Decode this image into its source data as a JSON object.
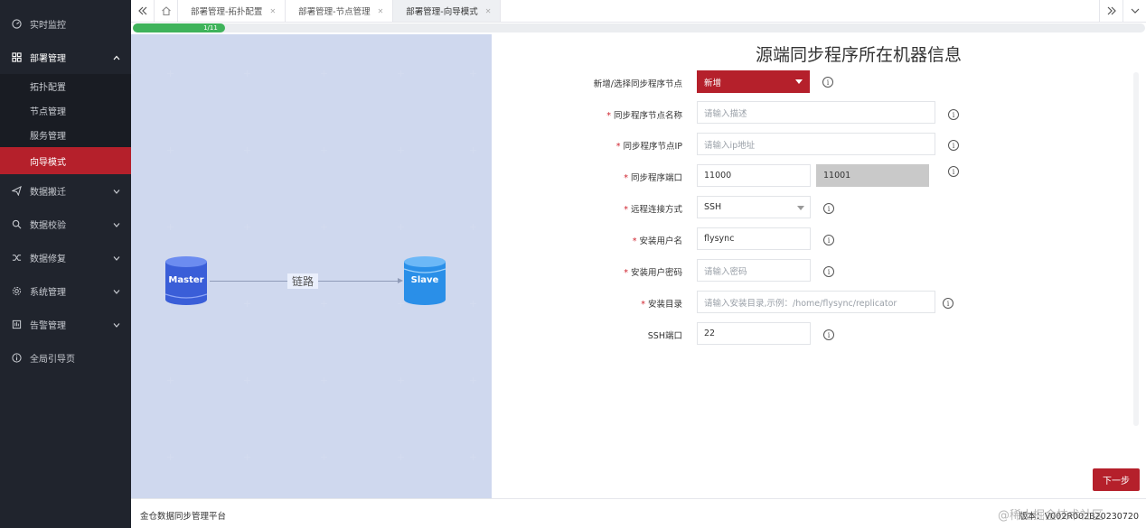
{
  "sidebar": {
    "items": [
      {
        "label": "实时监控",
        "icon": "dashboard-icon"
      },
      {
        "label": "部署管理",
        "icon": "deploy-icon",
        "expanded": true,
        "children": [
          {
            "label": "拓扑配置"
          },
          {
            "label": "节点管理"
          },
          {
            "label": "服务管理"
          },
          {
            "label": "向导模式",
            "active": true
          }
        ]
      },
      {
        "label": "数据搬迁",
        "icon": "send-icon"
      },
      {
        "label": "数据校验",
        "icon": "search-icon"
      },
      {
        "label": "数据修复",
        "icon": "shuffle-icon"
      },
      {
        "label": "系统管理",
        "icon": "gear-icon"
      },
      {
        "label": "告警管理",
        "icon": "alarm-icon"
      },
      {
        "label": "全局引导页",
        "icon": "info-icon"
      }
    ]
  },
  "tabs": [
    {
      "label": "部署管理-拓扑配置",
      "active": false
    },
    {
      "label": "部署管理-节点管理",
      "active": false
    },
    {
      "label": "部署管理-向导模式",
      "active": true
    }
  ],
  "progress": {
    "label": "1/11",
    "fraction": 0.0909
  },
  "diagram": {
    "source_label": "Master",
    "target_label": "Slave",
    "link_label": "链路"
  },
  "form": {
    "title": "源端同步程序所在机器信息",
    "fields": {
      "node_select": {
        "label": "新增/选择同步程序节点",
        "value": "新增",
        "required": false
      },
      "node_name": {
        "label": "同步程序节点名称",
        "placeholder": "请输入描述",
        "required": true
      },
      "node_ip": {
        "label": "同步程序节点IP",
        "placeholder": "请输入ip地址",
        "required": true
      },
      "port": {
        "label": "同步程序端口",
        "value": "11000",
        "value2": "11001",
        "required": true
      },
      "remote_method": {
        "label": "远程连接方式",
        "value": "SSH",
        "required": true
      },
      "install_user": {
        "label": "安装用户名",
        "value": "flysync",
        "required": true
      },
      "install_password": {
        "label": "安装用户密码",
        "placeholder": "请输入密码",
        "required": true
      },
      "install_dir": {
        "label": "安装目录",
        "placeholder": "请输入安装目录,示例：/home/flysync/replicator",
        "required": true
      },
      "ssh_port": {
        "label": "SSH端口",
        "value": "22",
        "required": false
      }
    },
    "info_symbol": "i",
    "next_label": "下一步"
  },
  "footer": {
    "left": "金仓数据同步管理平台",
    "right": "版本：V002R002B20230720"
  },
  "watermark": "@稀土掘金技术社区",
  "colors": {
    "brand_red": "#b5202b",
    "sidebar_bg": "#20242d",
    "progress_green": "#3fb35b",
    "diagram_bg": "#eaeffc"
  }
}
